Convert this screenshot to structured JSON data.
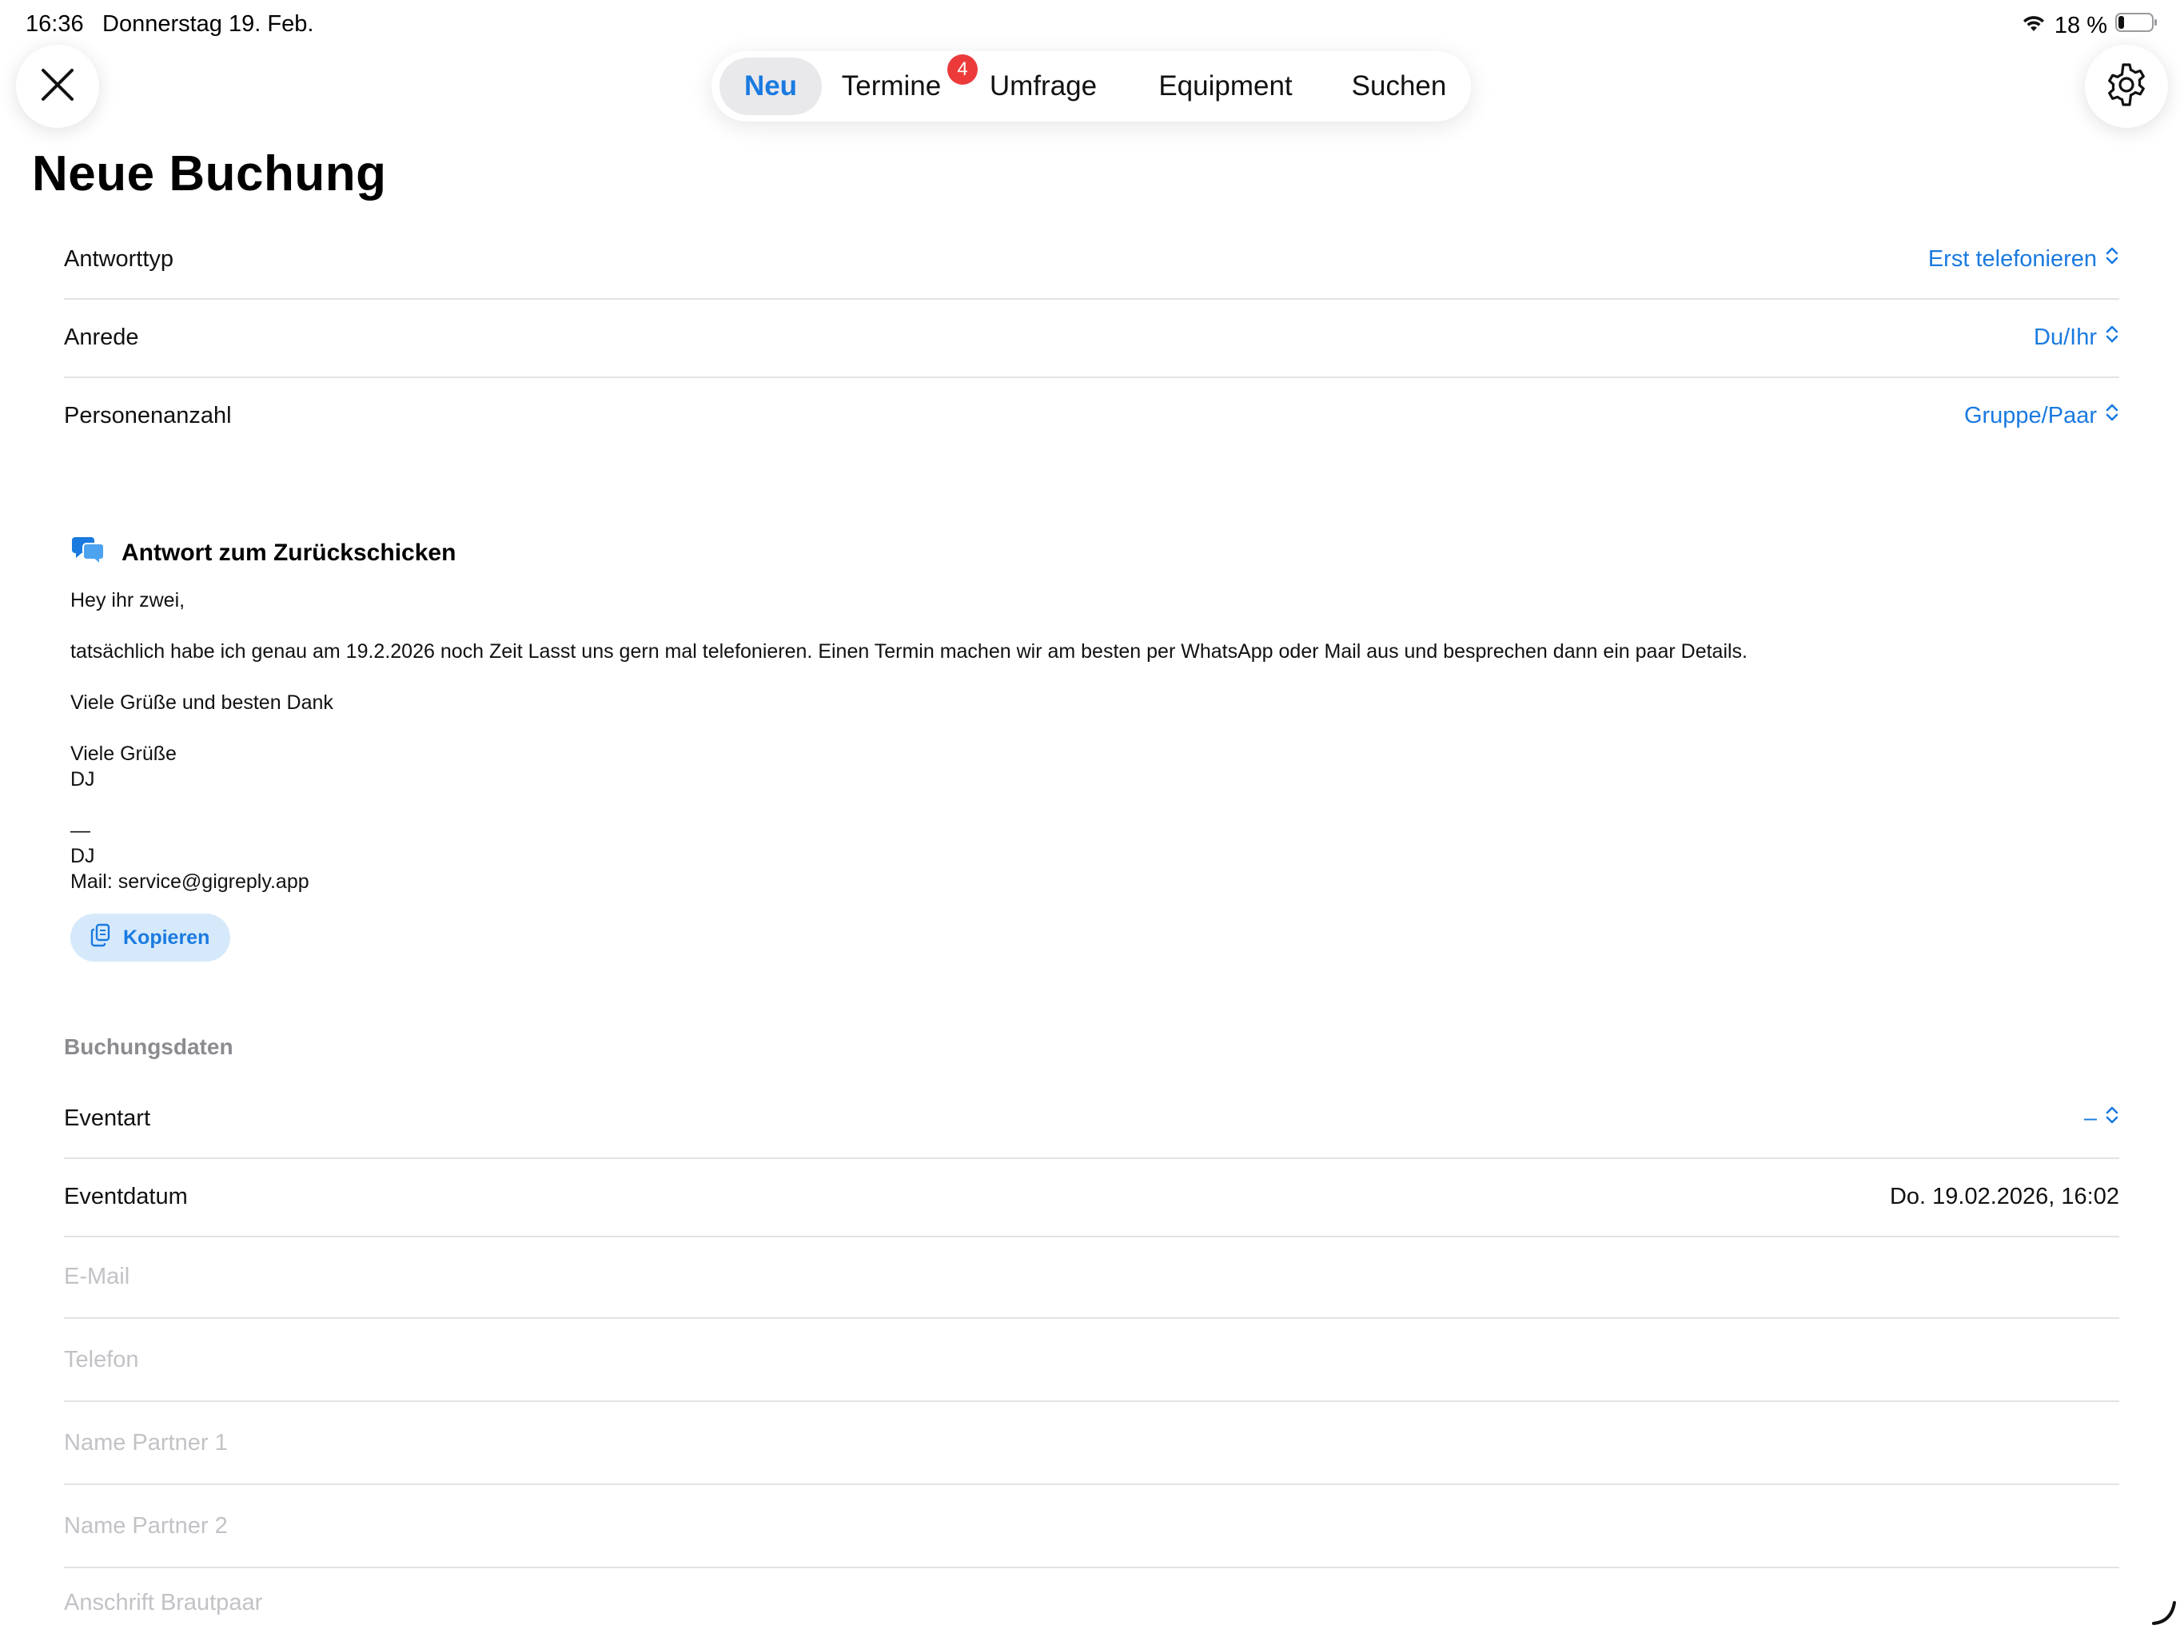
{
  "status_bar": {
    "time": "16:36",
    "date": "Donnerstag 19. Feb.",
    "battery": "18 %"
  },
  "icons": {
    "close": "close-icon",
    "settings": "gear-icon",
    "wifi": "wifi-icon",
    "battery": "battery-icon",
    "chat": "chat-bubbles-icon",
    "copy": "copy-icon",
    "chevron": "chevron-up-down-icon"
  },
  "colors": {
    "accent": "#1a7ae0",
    "badge": "#ec3a3a"
  },
  "tabs": [
    {
      "label": "Neu",
      "active": true
    },
    {
      "label": "Termine",
      "badge": "4"
    },
    {
      "label": "Umfrage"
    },
    {
      "label": "Equipment"
    },
    {
      "label": "Suchen"
    }
  ],
  "page_title": "Neue Buchung",
  "settings_rows": [
    {
      "label": "Antworttyp",
      "value": "Erst telefonieren"
    },
    {
      "label": "Anrede",
      "value": "Du/Ihr"
    },
    {
      "label": "Personenanzahl",
      "value": "Gruppe/Paar"
    }
  ],
  "response": {
    "title": "Antwort zum Zurückschicken",
    "text": "Hey ihr zwei,\n\ntatsächlich habe ich genau am 19.2.2026 noch Zeit Lasst uns gern mal telefonieren. Einen Termin machen wir am besten per WhatsApp oder Mail aus und besprechen dann ein paar Details.\n\nViele Grüße und besten Dank\n\nViele Grüße\nDJ\n\n—\nDJ\nMail: service@gigreply.app",
    "copy_label": "Kopieren"
  },
  "booking": {
    "section_title": "Buchungsdaten",
    "event_type_label": "Eventart",
    "event_type_value": "–",
    "event_date_label": "Eventdatum",
    "event_date_value": "Do. 19.02.2026, 16:02",
    "fields": {
      "email_placeholder": "E-Mail",
      "phone_placeholder": "Telefon",
      "partner1_placeholder": "Name Partner 1",
      "partner2_placeholder": "Name Partner 2",
      "address_placeholder": "Anschrift Brautpaar"
    }
  }
}
